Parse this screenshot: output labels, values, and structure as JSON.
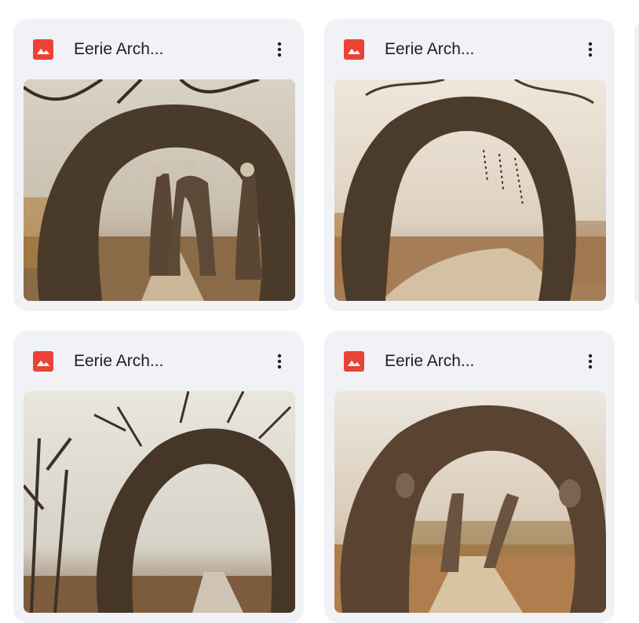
{
  "files": [
    {
      "title": "Eerie Arch...",
      "type_icon": "image-file-icon",
      "thumbnail": "skeleton-arch-forest-path"
    },
    {
      "title": "Eerie Arch...",
      "type_icon": "image-file-icon",
      "thumbnail": "tangled-vine-arch-misty-road"
    },
    {
      "title": "Eerie Arch...",
      "type_icon": "image-file-icon",
      "thumbnail": "bare-branch-arch-foggy-woods"
    },
    {
      "title": "Eerie Arch...",
      "type_icon": "image-file-icon",
      "thumbnail": "gnarled-arch-autumn-path"
    }
  ],
  "colors": {
    "card_bg": "#f0f2f6",
    "icon_red": "#ea4335",
    "title_text": "#1f1f1f"
  }
}
